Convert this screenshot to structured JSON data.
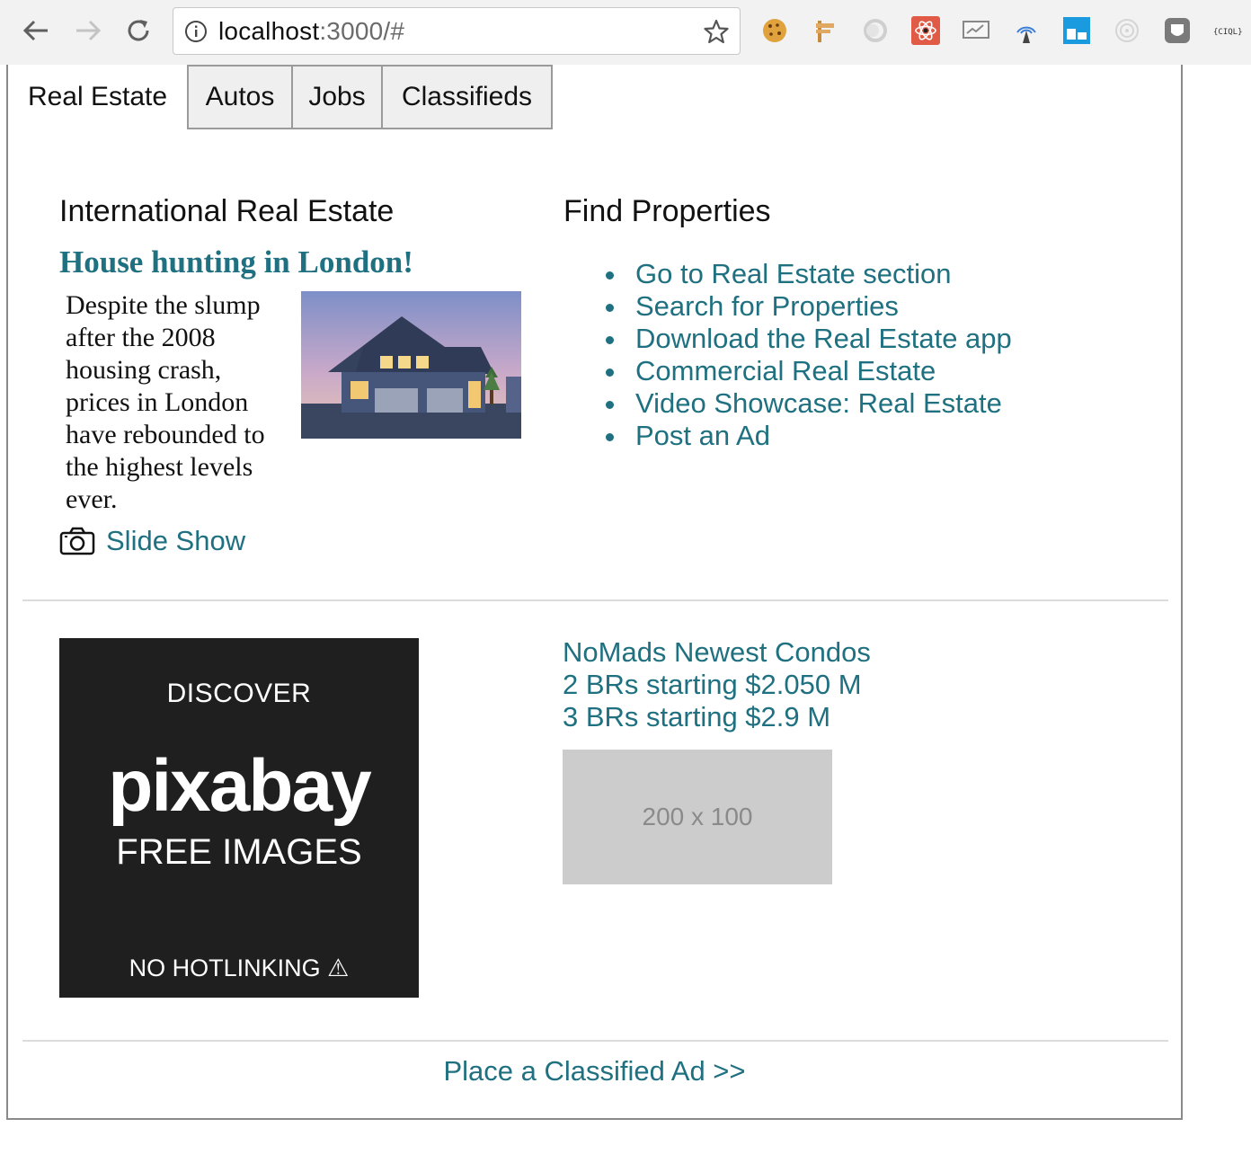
{
  "browser": {
    "url_host": "localhost",
    "url_rest": ":3000/#"
  },
  "tabs": [
    {
      "label": "Real Estate",
      "active": true
    },
    {
      "label": "Autos",
      "active": false
    },
    {
      "label": "Jobs",
      "active": false
    },
    {
      "label": "Classifieds",
      "active": false
    }
  ],
  "intl": {
    "title": "International Real Estate",
    "headline": "House hunting in London!",
    "story": "Despite the slump after the 2008 housing crash, prices in London have rebounded to the highest levels ever.",
    "slideshow_label": "Slide Show"
  },
  "find": {
    "title": "Find Properties",
    "links": [
      "Go to Real Estate section",
      "Search for Properties",
      "Download the Real Estate app",
      "Commercial Real Estate",
      "Video Showcase: Real Estate",
      "Post an Ad"
    ]
  },
  "ad_banner": {
    "discover": "DISCOVER",
    "brand": "pixabay",
    "free_images": "FREE IMAGES",
    "no_hotlinking": "NO HOTLINKING ⚠"
  },
  "condos": {
    "line1": "NoMads Newest Condos",
    "line2": "2 BRs starting $2.050 M",
    "line3": "3 BRs starting $2.9 M",
    "placeholder": "200 x 100"
  },
  "footer": {
    "place_ad": "Place a Classified Ad >>"
  },
  "colors": {
    "link": "#1f7080",
    "tab_inactive": "#efefef",
    "banner_bg": "#1f1f1f",
    "placeholder_bg": "#cccccc"
  }
}
